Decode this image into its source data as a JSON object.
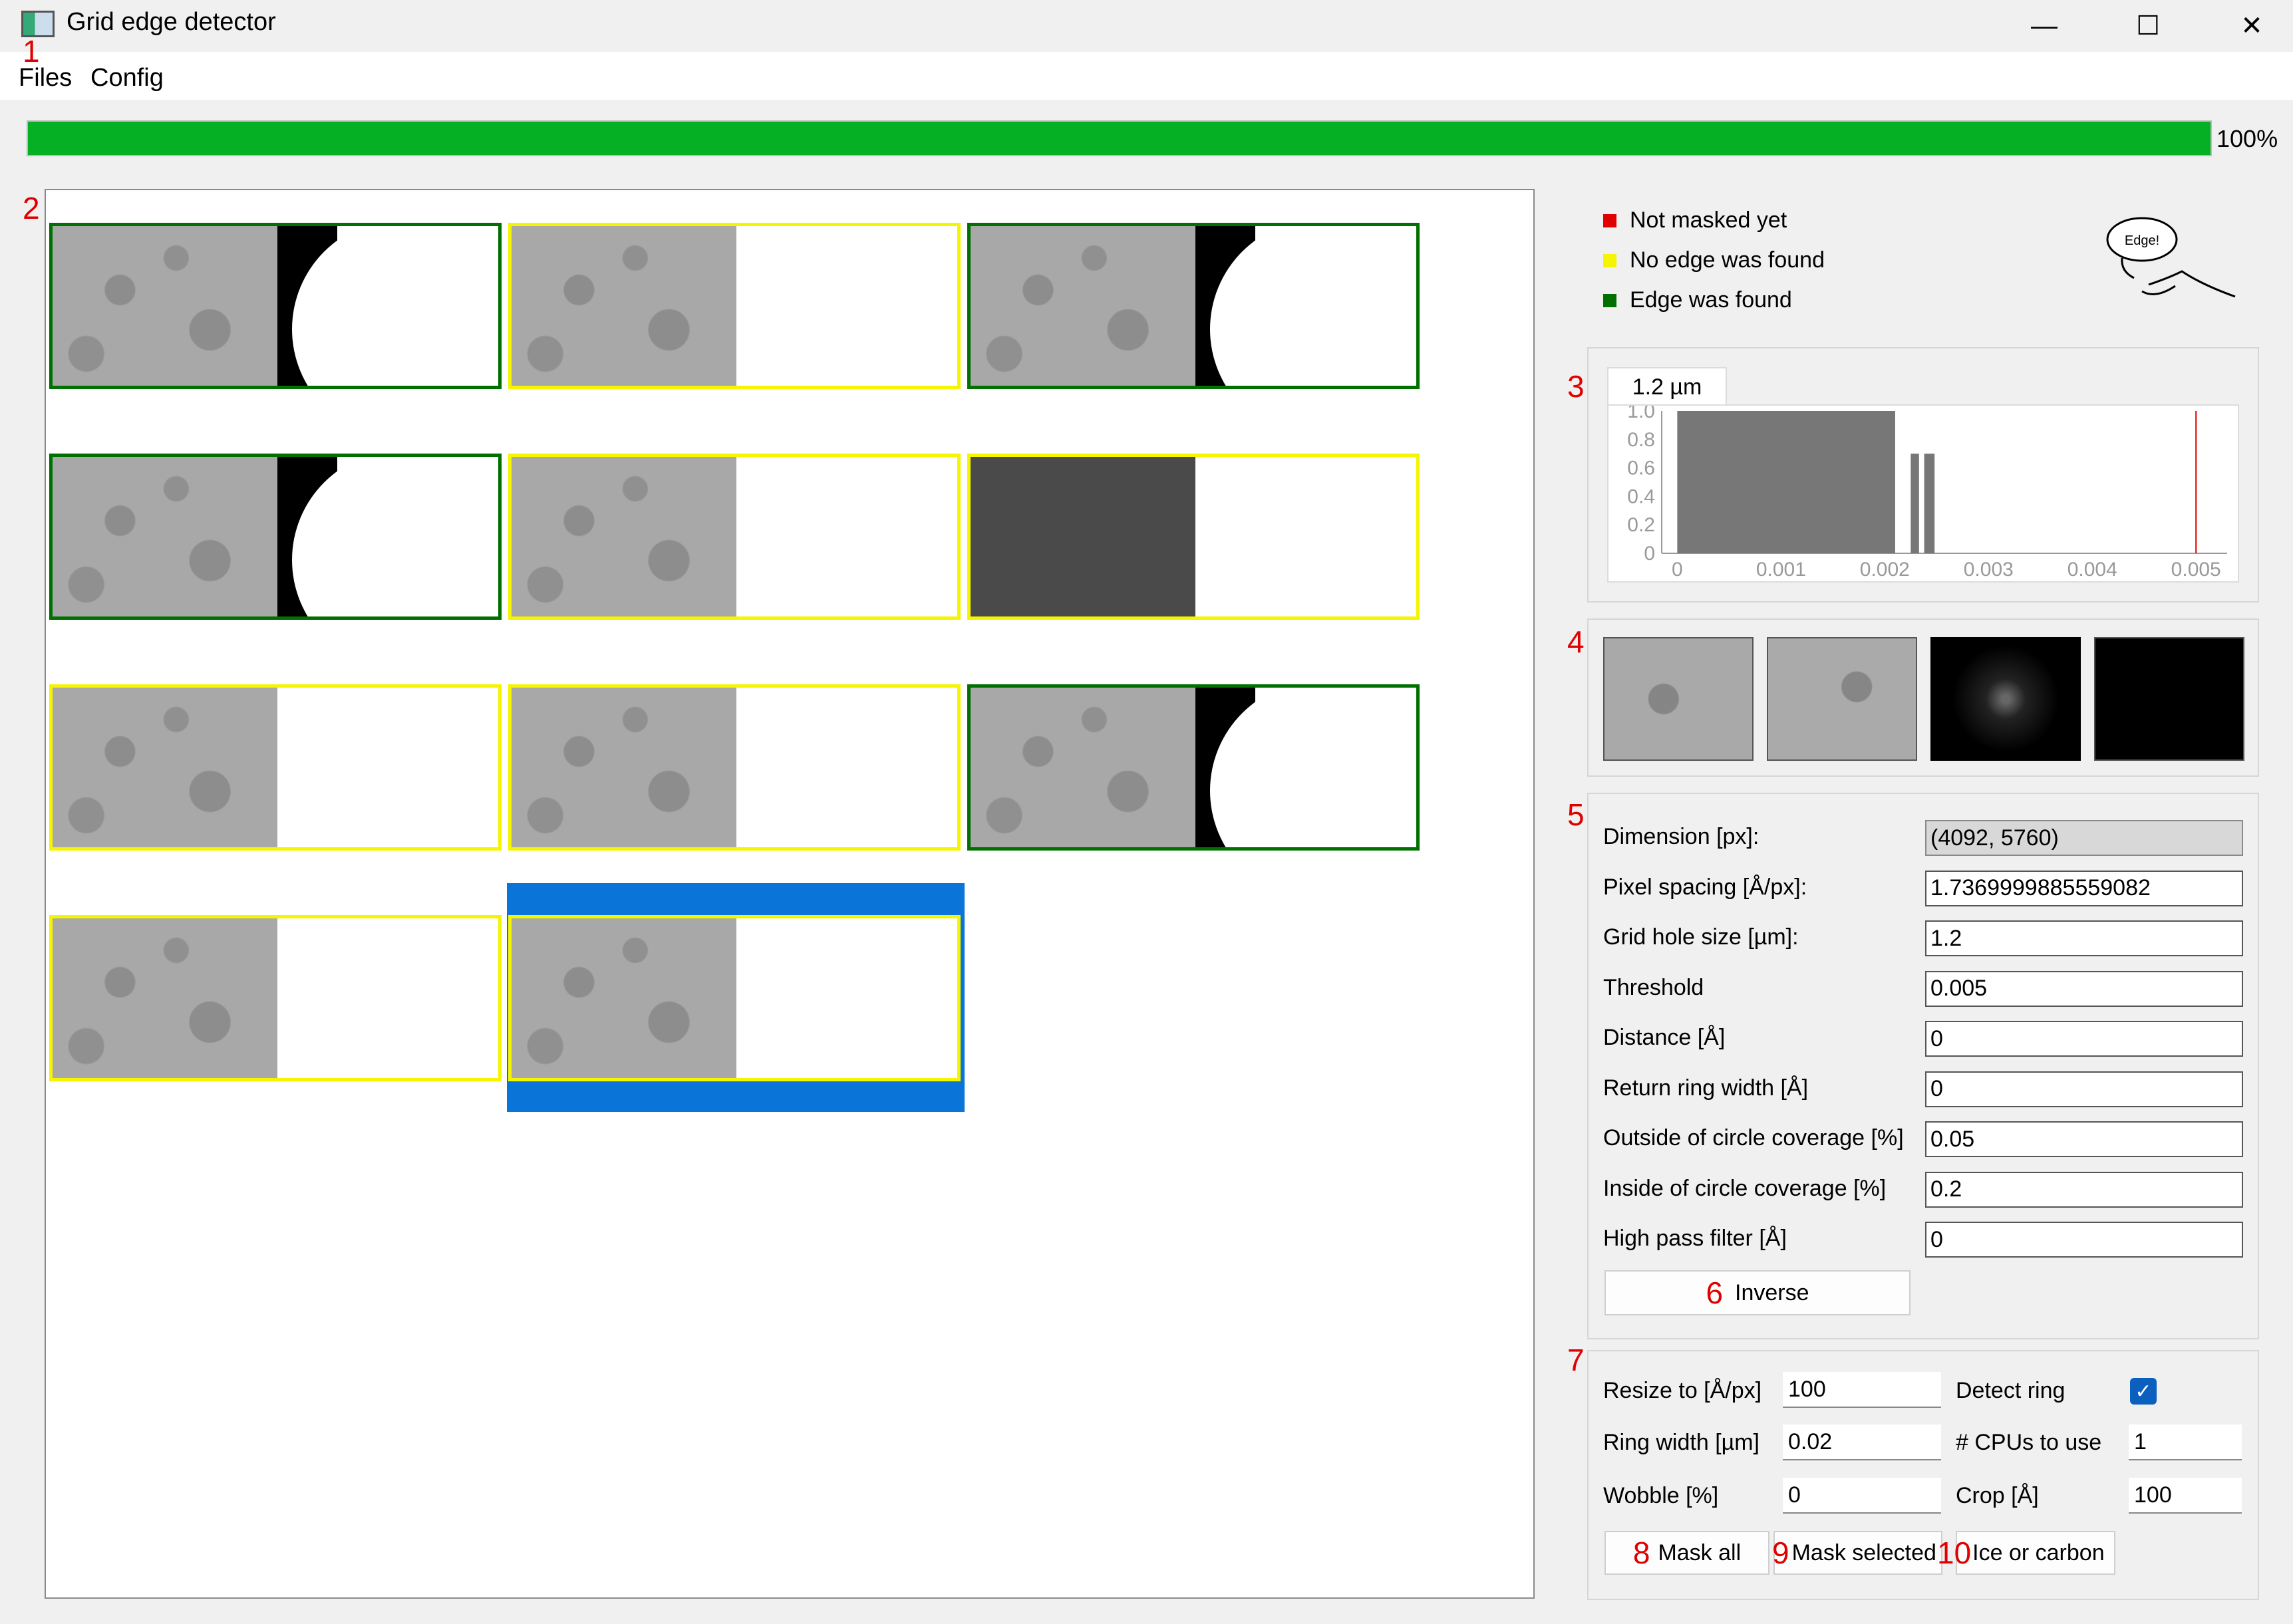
{
  "window": {
    "title": "Grid edge detector",
    "minimize_glyph": "—",
    "maximize_glyph": "☐",
    "close_glyph": "✕"
  },
  "menu": {
    "items": [
      "Files",
      "Config"
    ]
  },
  "callouts": [
    "1",
    "2",
    "3",
    "4",
    "5",
    "6",
    "7",
    "8",
    "9",
    "10"
  ],
  "progress": {
    "value": 1.0,
    "text": "100%",
    "color": "#06b025"
  },
  "legend": [
    {
      "label": "Not masked yet",
      "color": "#e00000"
    },
    {
      "label": "No edge was found",
      "color": "#f5f500"
    },
    {
      "label": "Edge was found",
      "color": "#007000"
    }
  ],
  "logo_text": "Edge!",
  "histogram": {
    "tab": "1.2 µm",
    "chart_data": {
      "type": "bar",
      "x_ticks": [
        "0",
        "0.001",
        "0.002",
        "0.003",
        "0.004",
        "0.005"
      ],
      "y_ticks": [
        "0",
        "0.2",
        "0.4",
        "0.6",
        "0.8",
        "1.0"
      ],
      "xlim": [
        -0.00015,
        0.0053
      ],
      "ylim": [
        0,
        1.0
      ],
      "bars": [
        {
          "x0": 0.0,
          "x1": 0.0021,
          "value": 1.0
        },
        {
          "x0": 0.00225,
          "x1": 0.00233,
          "value": 0.7
        },
        {
          "x0": 0.00238,
          "x1": 0.00248,
          "value": 0.7
        }
      ],
      "threshold": 0.005,
      "threshold_color": "#e00000"
    }
  },
  "thumbnails": [
    {
      "status": "edge",
      "kind": "circle"
    },
    {
      "status": "noedge",
      "kind": "blank"
    },
    {
      "status": "edge",
      "kind": "circle"
    },
    {
      "status": "edge",
      "kind": "circle"
    },
    {
      "status": "noedge",
      "kind": "blank"
    },
    {
      "status": "noedge",
      "kind": "blank",
      "dark": true
    },
    {
      "status": "noedge",
      "kind": "blank"
    },
    {
      "status": "noedge",
      "kind": "blank"
    },
    {
      "status": "edge",
      "kind": "circle"
    },
    {
      "status": "noedge",
      "kind": "blank"
    },
    {
      "status": "noedge",
      "kind": "blank",
      "selected": true
    }
  ],
  "status_colors": {
    "edge": "#007000",
    "noedge": "#f5f500",
    "selected": "#0a74d8"
  },
  "params": [
    {
      "label": "Dimension [px]:",
      "value": "(4092, 5760)",
      "readonly": true
    },
    {
      "label": "Pixel spacing [Å/px]:",
      "value": "1.7369999885559082"
    },
    {
      "label": "Grid hole size [µm]:",
      "value": "1.2"
    },
    {
      "label": "Threshold",
      "value": "0.005"
    },
    {
      "label": "Distance [Å]",
      "value": "0"
    },
    {
      "label": "Return ring width [Å]",
      "value": "0"
    },
    {
      "label": "Outside of circle coverage [%]",
      "value": "0.05"
    },
    {
      "label": "Inside of circle coverage [%]",
      "value": "0.2"
    },
    {
      "label": "High pass filter [Å]",
      "value": "0"
    }
  ],
  "inverse_button": "Inverse",
  "settings": {
    "resize_label": "Resize to [Å/px]",
    "resize_value": "100",
    "detect_ring_label": "Detect ring",
    "detect_ring_checked": true,
    "ring_width_label": "Ring width [µm]",
    "ring_width_value": "0.02",
    "cpus_label": "# CPUs to use",
    "cpus_value": "1",
    "wobble_label": "Wobble [%]",
    "wobble_value": "0",
    "crop_label": "Crop [Å]",
    "crop_value": "100"
  },
  "actions": {
    "mask_all": "Mask all",
    "mask_selected": "Mask selected",
    "ice_or_carbon": "Ice or carbon"
  }
}
